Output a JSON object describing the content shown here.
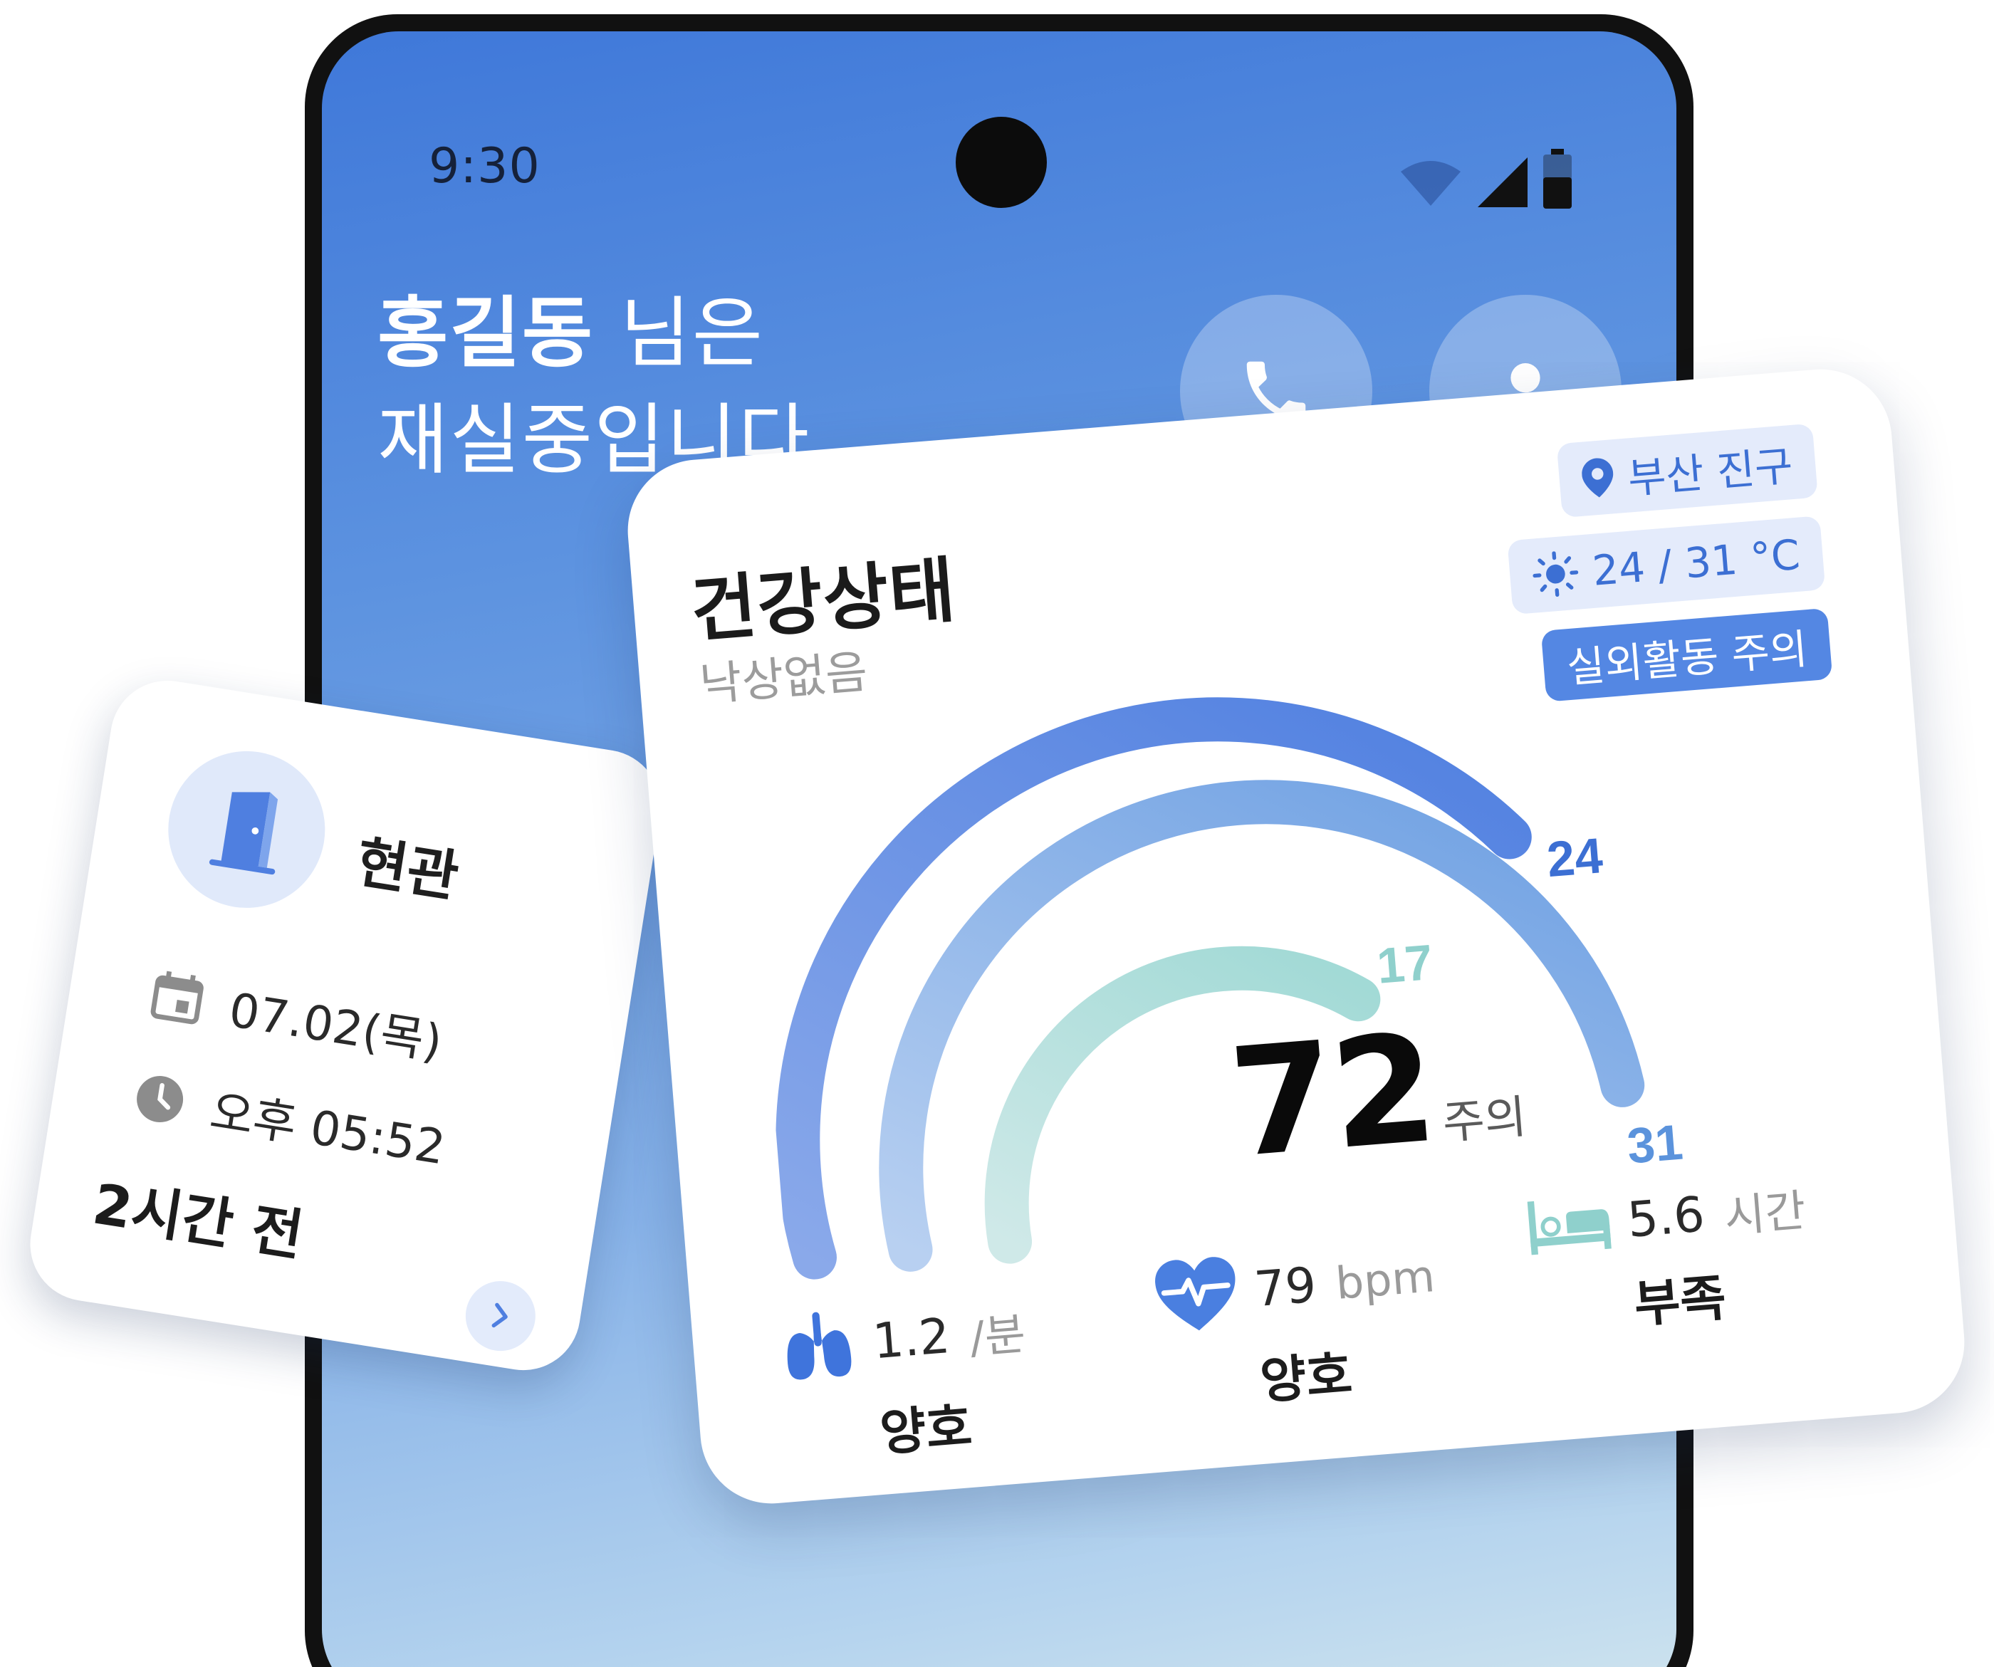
{
  "status_bar": {
    "time": "9:30"
  },
  "greeting": {
    "name": "홍길동",
    "suffix": " 님은",
    "line2": "재실중입니다."
  },
  "door_card": {
    "title": "현관",
    "date": "07.02(목)",
    "time": "오후 05:52",
    "ago": "2시간 전",
    "icons": [
      "door-icon",
      "calendar-icon",
      "clock-icon",
      "chevron-right-icon"
    ]
  },
  "health_card": {
    "title": "건강상태",
    "subtitle": "낙상없음",
    "location": "부산 진구",
    "weather": "24 / 31 °C",
    "alert": "실외활동 주의",
    "score": "72",
    "score_label": "주의",
    "gauge": {
      "arcs": [
        {
          "label": "24",
          "fraction": 0.9,
          "color": "#4f7fe0"
        },
        {
          "label": "31",
          "fraction": 0.9,
          "color": "#6b9ee2"
        },
        {
          "label": "17",
          "fraction": 0.62,
          "color": "#a9dcd8"
        }
      ]
    },
    "metrics": [
      {
        "icon": "lungs-icon",
        "value": "1.2",
        "unit": "/분",
        "status": "양호"
      },
      {
        "icon": "heart-rate-icon",
        "value": "79",
        "unit": "bpm",
        "status": "양호"
      },
      {
        "icon": "bed-icon",
        "value": "5.6",
        "unit": "시간",
        "status": "부족"
      }
    ]
  },
  "colors": {
    "accent": "#4f7fe0",
    "teal": "#8fd0cc",
    "text_dark": "#1b1b1b",
    "text_muted": "#9c9c9c"
  }
}
